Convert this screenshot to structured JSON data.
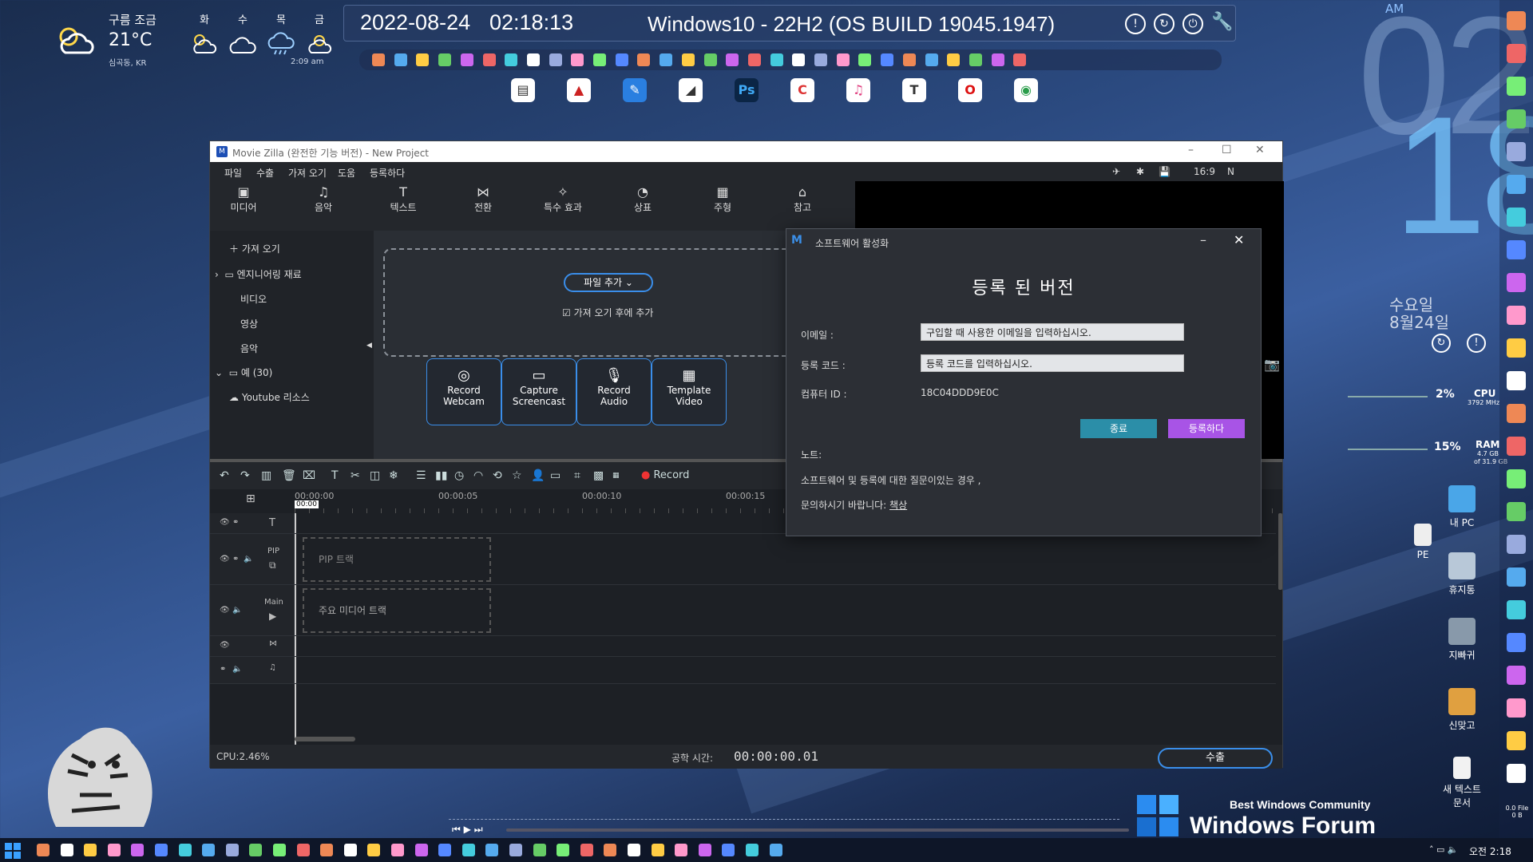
{
  "weather": {
    "condition": "구름 조금",
    "temp": "21°C",
    "location": "심곡동, KR",
    "days": [
      "화",
      "수",
      "목",
      "금"
    ],
    "updated": "2:09 am"
  },
  "topbar": {
    "date": "2022-08-24",
    "time": "02:18:13",
    "os": "Windows10 - 22H2 (OS BUILD 19045.1947)"
  },
  "clock": {
    "ampm": "AM",
    "hour": "02",
    "minute": "18",
    "weekday": "수요일",
    "date": "8월24일"
  },
  "meters": {
    "cpu_pct": "2%",
    "cpu_label": "CPU",
    "cpu_mhz": "3792 MHz",
    "ram_pct": "15%",
    "ram_label": "RAM",
    "ram_used": "4.7 GB",
    "ram_total": "of 31.9 GB"
  },
  "desktop_icons": {
    "mypc": "내 PC",
    "pe": "PE",
    "recycle": "휴지통",
    "jibbagwi": "지빠귀",
    "game": "신맞고",
    "newtext": "새 텍스트\n문서",
    "disk": "0.0 File\n0 B"
  },
  "app": {
    "title": "Movie Zilla (완전한 기능 버전) - New Project",
    "menu": [
      "파일",
      "수출",
      "가져 오기",
      "도움",
      "등록하다"
    ],
    "menu_right": {
      "ratio": "16:9",
      "n": "N"
    },
    "tools": [
      "미디어",
      "음악",
      "텍스트",
      "전환",
      "특수 효과",
      "상표",
      "주형",
      "참고"
    ],
    "sidebar": {
      "import": "가져 오기",
      "eng": "엔지니어링 재료",
      "video": "비디오",
      "image": "영상",
      "music": "음악",
      "example": "예 (30)",
      "youtube": "Youtube 리소스"
    },
    "add_file": "파일 추가",
    "add_after_import": "가져 오기 후에 추가",
    "cards": [
      {
        "l1": "Record",
        "l2": "Webcam"
      },
      {
        "l1": "Capture",
        "l2": "Screencast"
      },
      {
        "l1": "Record",
        "l2": "Audio"
      },
      {
        "l1": "Template",
        "l2": "Video"
      }
    ],
    "record_label": "Record",
    "ruler": [
      "00:00:00",
      "00:00:05",
      "00:00:10",
      "00:00:15"
    ],
    "playhead": "00:00",
    "tracks": {
      "pip": "PIP",
      "pip_box": "PIP 트랙",
      "main": "Main",
      "main_box": "주요 미디어 트랙"
    },
    "status": {
      "cpu": "CPU:2.46%",
      "total_time_label": "공학 시간:",
      "total_time": "00:00:00.01",
      "export": "수출"
    }
  },
  "dialog": {
    "title": "소프트웨어 활성화",
    "heading": "등록 된 버전",
    "email_label": "이메일 :",
    "email_value": "구입할 때 사용한 이메일을 입력하십시오.",
    "code_label": "등록 코드 :",
    "code_value": "등록 코드를 입력하십시오.",
    "pcid_label": "컴퓨터 ID :",
    "pcid_value": "18C04DDD9E0C",
    "cancel": "종료",
    "register": "등록하다",
    "note_label": "노트:",
    "note_line1": "소프트웨어 및 등록에 대한 질문이있는 경우 ,",
    "note_line2_prefix": "문의하시기 바랍니다:",
    "note_link": "책상"
  },
  "brand": {
    "line1": "Best Windows Community",
    "line2": "Windows Forum"
  },
  "taskbar": {
    "time": "오전 2:18"
  }
}
